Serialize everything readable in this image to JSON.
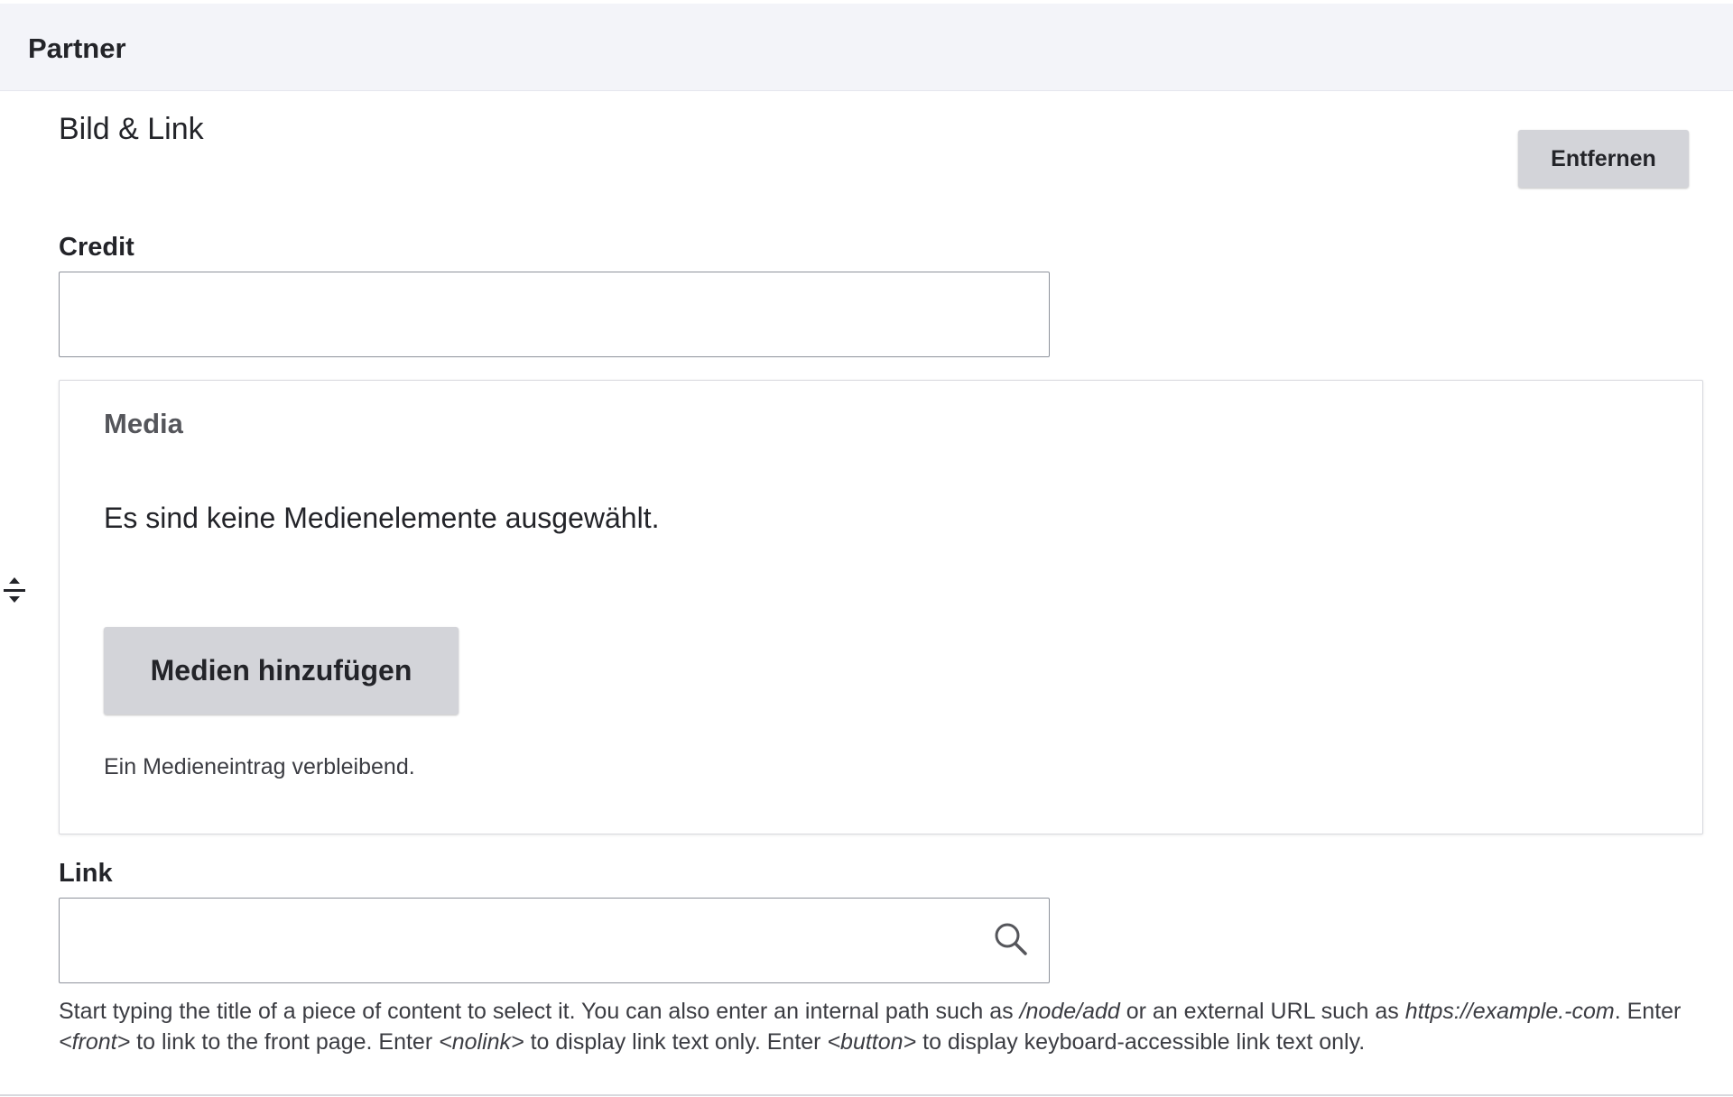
{
  "header": {
    "title": "Partner"
  },
  "paragraph": {
    "type_label": "Bild & Link",
    "remove_label": "Entfernen"
  },
  "credit": {
    "label": "Credit",
    "value": "",
    "placeholder": ""
  },
  "media": {
    "legend": "Media",
    "empty_message": "Es sind keine Medienelemente ausgewählt.",
    "add_button_label": "Medien hinzufügen",
    "remaining_text": "Ein Medieneintrag verbleibend."
  },
  "link": {
    "label": "Link",
    "value": "",
    "placeholder": "",
    "description": {
      "t1": "Start typing the title of a piece of content to select it. You can also enter an internal path such as ",
      "e1": "/node/add",
      "t2": " or an external URL such as ",
      "e2": "https://example.-com",
      "t3": ". Enter ",
      "e3": "<front>",
      "t4": " to link to the front page. Enter ",
      "e4": "<nolink>",
      "t5": " to display link text only. Enter ",
      "e5": "<button>",
      "t6": " to display keyboard-accessible link text only."
    }
  },
  "icons": {
    "drag": "drag-handle-icon",
    "search": "search-icon"
  },
  "colors": {
    "header_bg": "#f3f4f9",
    "button_bg": "#d3d4d9",
    "text": "#232429",
    "border": "#8e929c"
  }
}
